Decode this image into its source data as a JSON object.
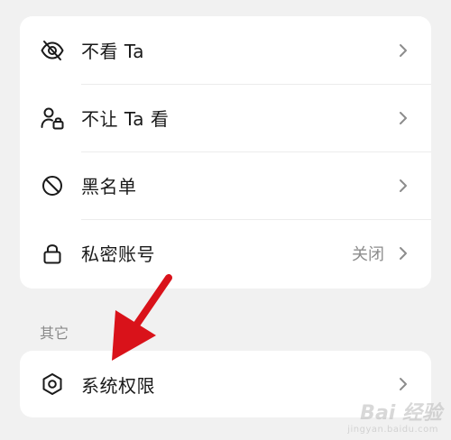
{
  "main_list": {
    "items": [
      {
        "label": "不看 Ta",
        "icon": "eye-off-icon"
      },
      {
        "label": "不让 Ta 看",
        "icon": "user-lock-icon"
      },
      {
        "label": "黑名单",
        "icon": "block-icon"
      },
      {
        "label": "私密账号",
        "icon": "lock-icon",
        "value": "关闭"
      }
    ]
  },
  "other_section": {
    "title": "其它",
    "items": [
      {
        "label": "系统权限",
        "icon": "hexagon-settings-icon"
      }
    ]
  },
  "annotation": {
    "arrow_color": "#d9121a"
  },
  "watermark": {
    "text": "Bai 经验",
    "subtext": "jingyan.baidu.com"
  },
  "colors": {
    "background": "#f1f1f1",
    "card": "#ffffff",
    "text": "#1a1a1a",
    "secondary": "#8c8c8c"
  }
}
